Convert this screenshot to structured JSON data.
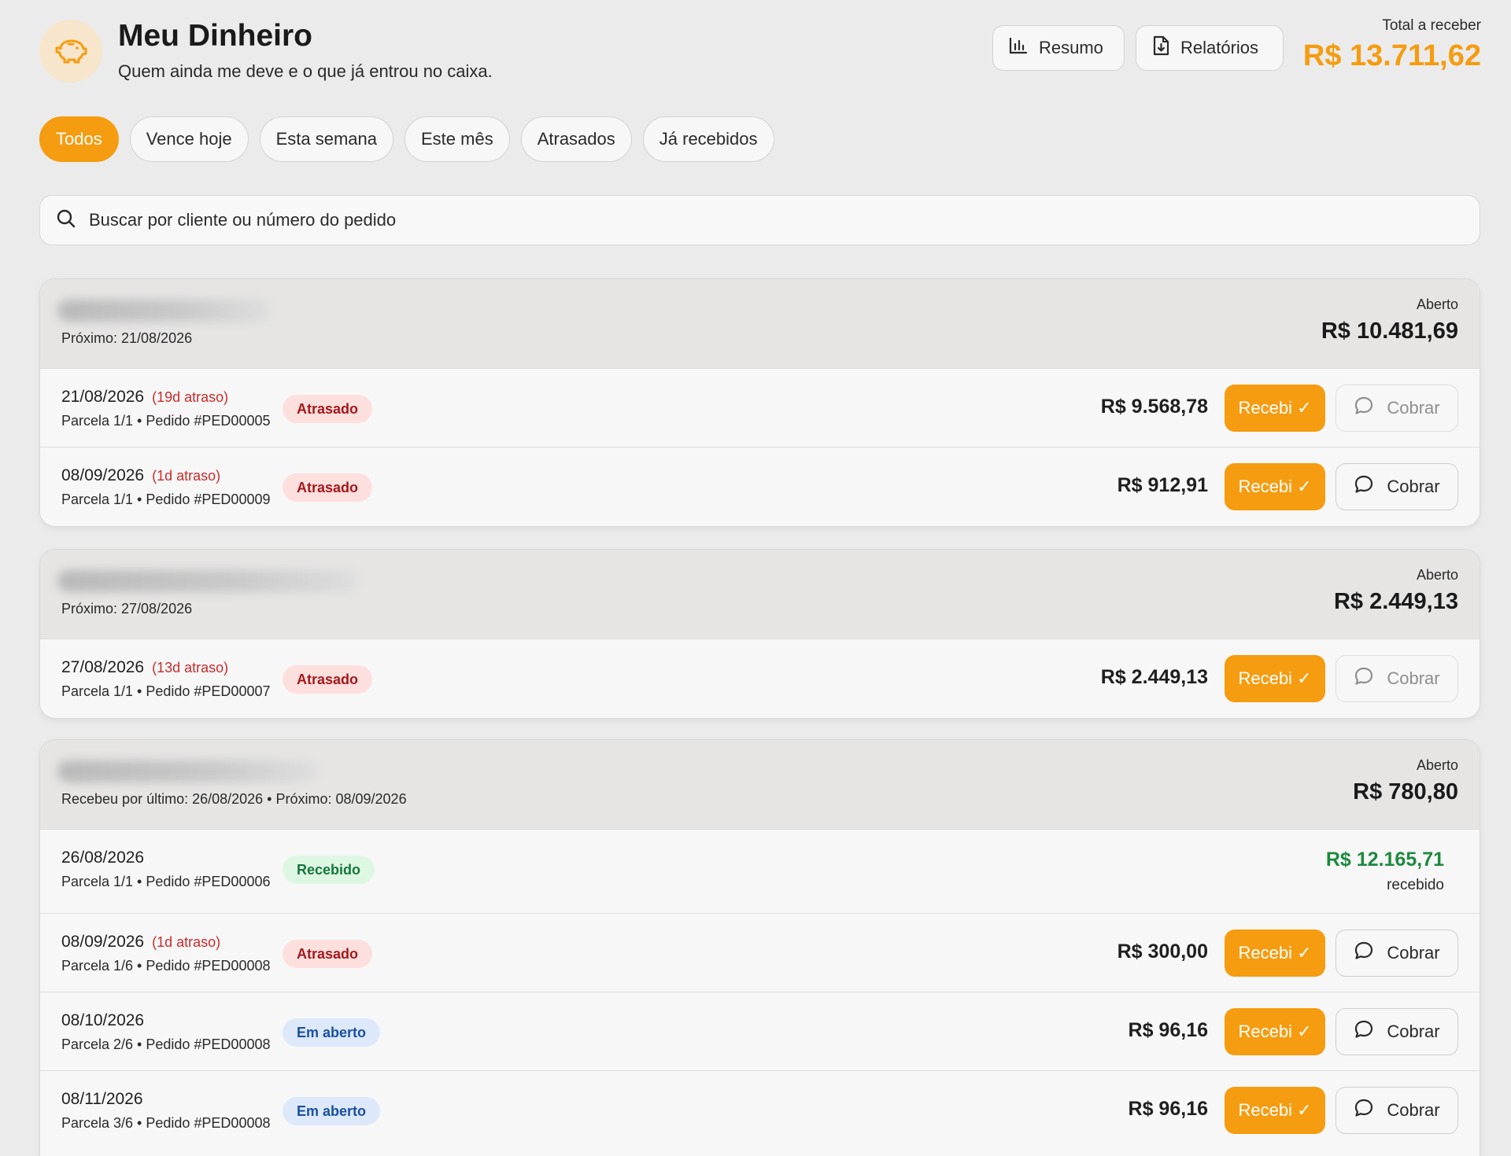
{
  "header": {
    "title": "Meu Dinheiro",
    "subtitle": "Quem ainda me deve e o que já entrou no caixa.",
    "logo_icon": "piggy-bank-icon",
    "buttons": [
      {
        "label": "Resumo",
        "icon": "bar-chart-icon"
      },
      {
        "label": "Relatórios",
        "icon": "file-download-icon"
      }
    ],
    "total_label": "Total a receber",
    "total_value": "R$ 13.711,62"
  },
  "filters": [
    {
      "label": "Todos",
      "active": true
    },
    {
      "label": "Vence hoje",
      "active": false
    },
    {
      "label": "Esta semana",
      "active": false
    },
    {
      "label": "Este mês",
      "active": false
    },
    {
      "label": "Atrasados",
      "active": false
    },
    {
      "label": "Já recebidos",
      "active": false
    }
  ],
  "search": {
    "placeholder": "Buscar por cliente ou número do pedido",
    "value": ""
  },
  "action_labels": {
    "recebi": "Recebi ✓",
    "cobrar": "Cobrar"
  },
  "colors": {
    "accent": "#f59c10",
    "late_text": "#a3191c",
    "paid_text": "#17773a",
    "open_text": "#1c4fa0",
    "received_amount": "#1d8a3f"
  },
  "groups": [
    {
      "meta": "Próximo: 21/08/2026",
      "status": "Aberto",
      "amount": "R$ 10.481,69",
      "rows": [
        {
          "date": "21/08/2026",
          "delay": "(19d atraso)",
          "sub": "Parcela 1/1 • Pedido #PED00005",
          "badge": "Atrasado",
          "amount": "R$ 9.568,78"
        },
        {
          "date": "08/09/2026",
          "delay": "(1d atraso)",
          "sub": "Parcela 1/1 • Pedido #PED00009",
          "badge": "Atrasado",
          "amount": "R$ 912,91"
        }
      ]
    },
    {
      "meta": "Próximo: 27/08/2026",
      "status": "Aberto",
      "amount": "R$ 2.449,13",
      "rows": [
        {
          "date": "27/08/2026",
          "delay": "(13d atraso)",
          "sub": "Parcela 1/1 • Pedido #PED00007",
          "badge": "Atrasado",
          "amount": "R$ 2.449,13"
        }
      ]
    },
    {
      "meta": "Recebeu por último: 26/08/2026 • Próximo: 08/09/2026",
      "status": "Aberto",
      "amount": "R$ 780,80",
      "rows": [
        {
          "date": "26/08/2026",
          "delay": "",
          "sub": "Parcela 1/1 • Pedido #PED00006",
          "badge": "Recebido",
          "amount": "R$ 12.165,71",
          "amount_note": "recebido"
        },
        {
          "date": "08/09/2026",
          "delay": "(1d atraso)",
          "sub": "Parcela 1/6 • Pedido #PED00008",
          "badge": "Atrasado",
          "amount": "R$ 300,00"
        },
        {
          "date": "08/10/2026",
          "delay": "",
          "sub": "Parcela 2/6 • Pedido #PED00008",
          "badge": "Em aberto",
          "amount": "R$ 96,16"
        },
        {
          "date": "08/11/2026",
          "delay": "",
          "sub": "Parcela 3/6 • Pedido #PED00008",
          "badge": "Em aberto",
          "amount": "R$ 96,16"
        }
      ]
    }
  ]
}
